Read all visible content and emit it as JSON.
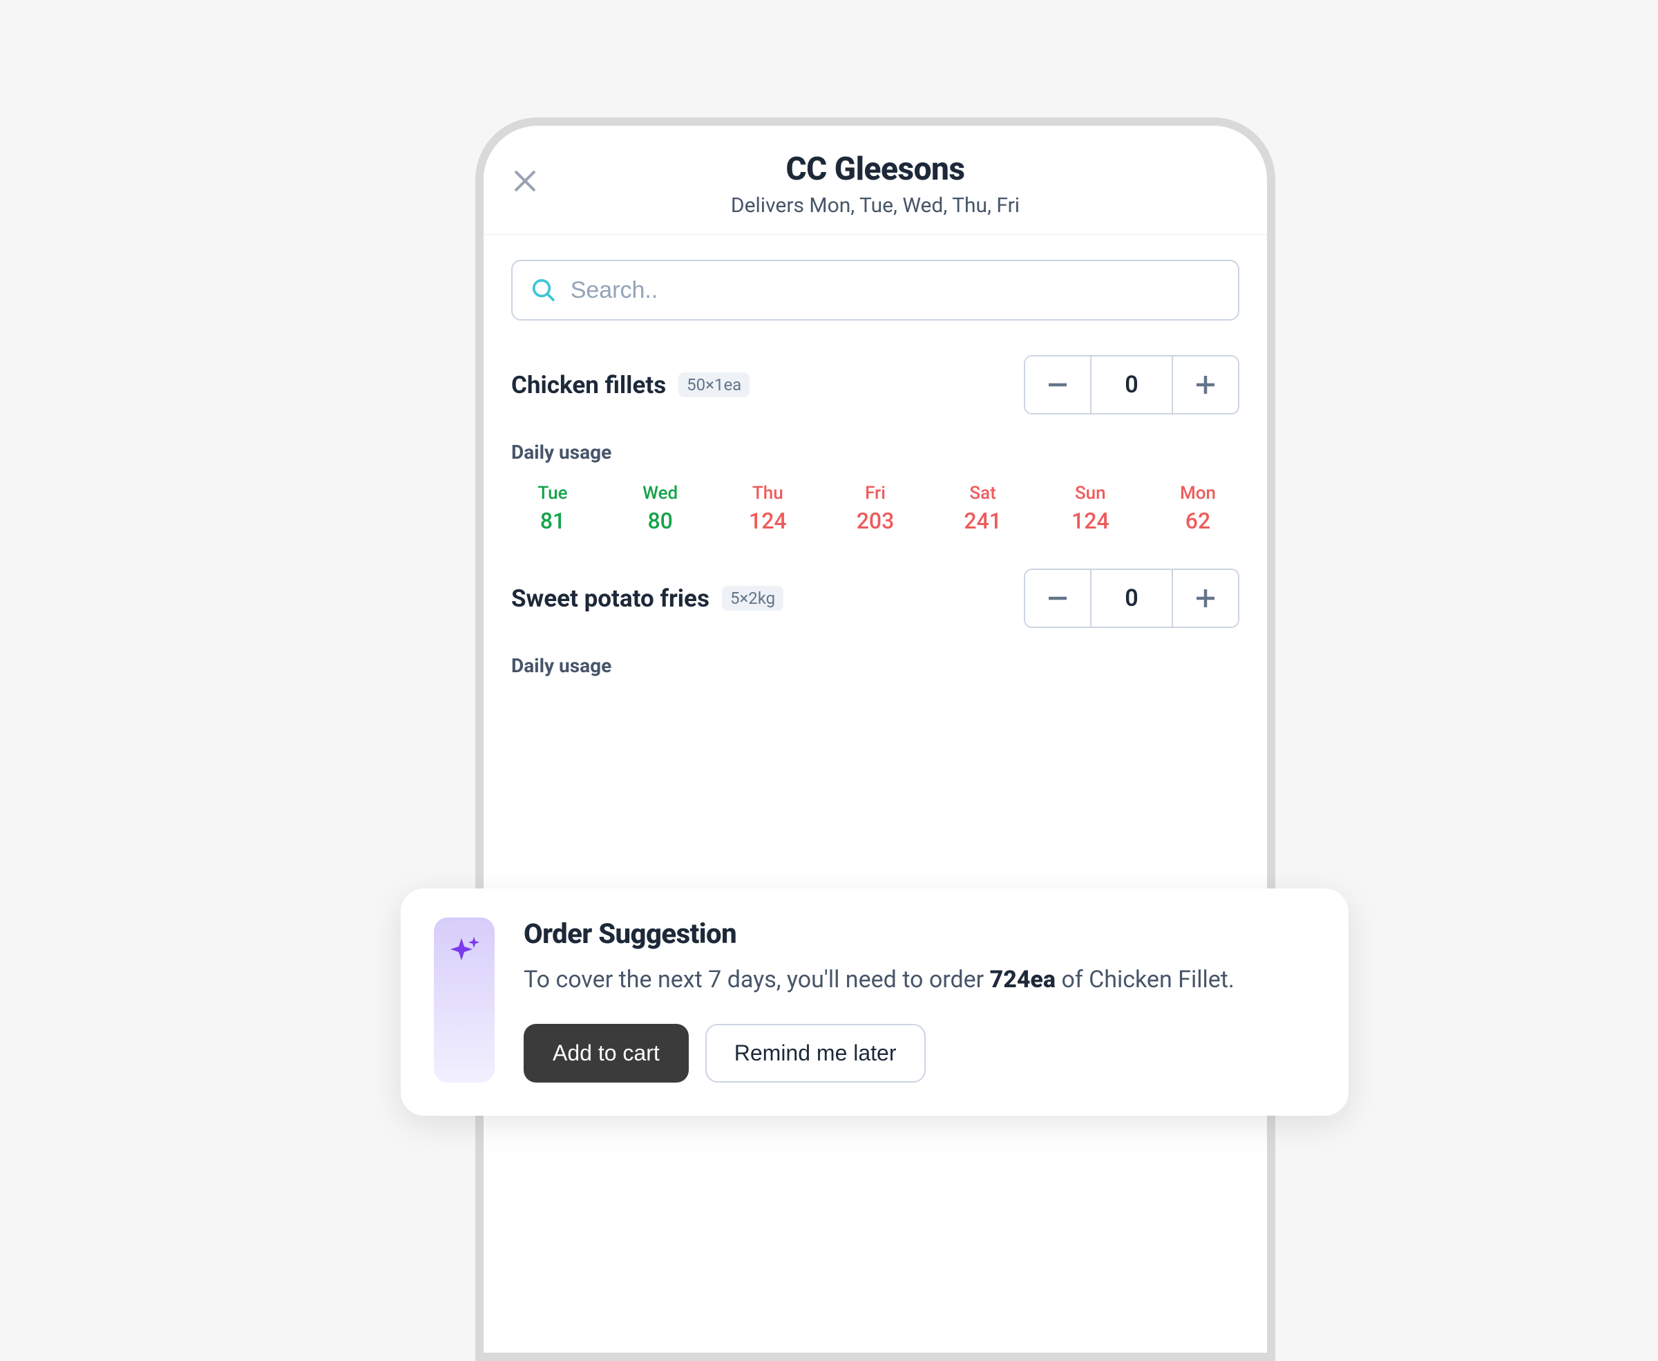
{
  "header": {
    "title": "CC Gleesons",
    "subtitle": "Delivers Mon, Tue, Wed, Thu, Fri"
  },
  "search": {
    "placeholder": "Search.."
  },
  "daily_usage_label": "Daily usage",
  "products": [
    {
      "name": "Chicken fillets",
      "unit": "50×1ea",
      "qty": "0",
      "usage": [
        {
          "day": "Tue",
          "val": "81",
          "cls": "green"
        },
        {
          "day": "Wed",
          "val": "80",
          "cls": "green"
        },
        {
          "day": "Thu",
          "val": "124",
          "cls": "red"
        },
        {
          "day": "Fri",
          "val": "203",
          "cls": "red"
        },
        {
          "day": "Sat",
          "val": "241",
          "cls": "red"
        },
        {
          "day": "Sun",
          "val": "124",
          "cls": "red"
        },
        {
          "day": "Mon",
          "val": "62",
          "cls": "red"
        }
      ]
    },
    {
      "name": "Sweet potato fries",
      "unit": "5×2kg",
      "qty": "0"
    }
  ],
  "suggestion": {
    "title": "Order Suggestion",
    "text_prefix": "To cover the next 7 days, you'll need to order ",
    "amount": "724ea",
    "text_suffix": " of Chicken Fillet.",
    "primary": "Add to cart",
    "secondary": "Remind me later"
  }
}
